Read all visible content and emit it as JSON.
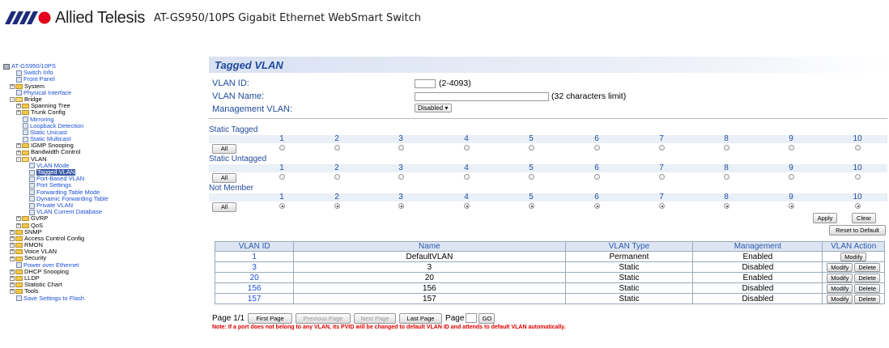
{
  "header": {
    "brand": "Allied Telesis",
    "model_title": "AT-GS950/10PS Gigabit Ethernet WebSmart Switch"
  },
  "tree": [
    {
      "label": "AT-GS950/10PS",
      "type": "root",
      "indent": 0
    },
    {
      "label": "Switch Info",
      "type": "page",
      "indent": 1
    },
    {
      "label": "Front Panel",
      "type": "page",
      "indent": 1
    },
    {
      "label": "System",
      "type": "folder",
      "indent": 1,
      "expand": "+"
    },
    {
      "label": "Physical Interface",
      "type": "page",
      "indent": 1
    },
    {
      "label": "Bridge",
      "type": "folder-open",
      "indent": 1,
      "expand": "-"
    },
    {
      "label": "Spanning Tree",
      "type": "folder",
      "indent": 2,
      "expand": "+"
    },
    {
      "label": "Trunk Config",
      "type": "folder",
      "indent": 2,
      "expand": "+"
    },
    {
      "label": "Mirroring",
      "type": "page",
      "indent": 2
    },
    {
      "label": "Loopback Detection",
      "type": "page",
      "indent": 2
    },
    {
      "label": "Static Unicast",
      "type": "page",
      "indent": 2
    },
    {
      "label": "Static Multicast",
      "type": "page",
      "indent": 2
    },
    {
      "label": "IGMP Snooping",
      "type": "folder",
      "indent": 2,
      "expand": "+"
    },
    {
      "label": "Bandwidth Control",
      "type": "folder",
      "indent": 2,
      "expand": "+"
    },
    {
      "label": "VLAN",
      "type": "folder-open",
      "indent": 2,
      "expand": "-"
    },
    {
      "label": "VLAN Mode",
      "type": "page",
      "indent": 3
    },
    {
      "label": "Tagged VLAN",
      "type": "page",
      "indent": 3,
      "selected": true
    },
    {
      "label": "Port-Based VLAN",
      "type": "page",
      "indent": 3
    },
    {
      "label": "Port Settings",
      "type": "page",
      "indent": 3
    },
    {
      "label": "Forwarding Table Mode",
      "type": "page",
      "indent": 3
    },
    {
      "label": "Dynamic Forwarding Table",
      "type": "page",
      "indent": 3
    },
    {
      "label": "Private VLAN",
      "type": "page",
      "indent": 3
    },
    {
      "label": "VLAN Current Database",
      "type": "page",
      "indent": 3
    },
    {
      "label": "GVRP",
      "type": "folder",
      "indent": 2,
      "expand": "+"
    },
    {
      "label": "QoS",
      "type": "folder",
      "indent": 2,
      "expand": "+"
    },
    {
      "label": "SNMP",
      "type": "folder",
      "indent": 1,
      "expand": "+"
    },
    {
      "label": "Access Control Config",
      "type": "folder",
      "indent": 1,
      "expand": "+"
    },
    {
      "label": "RMON",
      "type": "folder",
      "indent": 1,
      "expand": "+"
    },
    {
      "label": "Voice VLAN",
      "type": "folder",
      "indent": 1,
      "expand": "+"
    },
    {
      "label": "Security",
      "type": "folder",
      "indent": 1,
      "expand": "+"
    },
    {
      "label": "Power over Ethernet",
      "type": "page",
      "indent": 1
    },
    {
      "label": "DHCP Snooping",
      "type": "folder",
      "indent": 1,
      "expand": "+"
    },
    {
      "label": "LLDP",
      "type": "folder",
      "indent": 1,
      "expand": "+"
    },
    {
      "label": "Statistic Chart",
      "type": "folder",
      "indent": 1,
      "expand": "+"
    },
    {
      "label": "Tools",
      "type": "folder",
      "indent": 1,
      "expand": "+"
    },
    {
      "label": "Save Settings to Flash",
      "type": "page",
      "indent": 1
    }
  ],
  "main": {
    "title": "Tagged VLAN",
    "vlan_id_label": "VLAN ID:",
    "vlan_id_value": "",
    "vlan_id_hint": "(2-4093)",
    "vlan_name_label": "VLAN Name:",
    "vlan_name_value": "",
    "vlan_name_hint": "(32 characters limit)",
    "mgmt_label": "Management VLAN:",
    "mgmt_value": "Disabled",
    "sections": [
      {
        "label": "Static Tagged",
        "all": "All",
        "checked": []
      },
      {
        "label": "Static Untagged",
        "all": "All",
        "checked": []
      },
      {
        "label": "Not Member",
        "all": "All",
        "checked": [
          1,
          2,
          3,
          4,
          5,
          6,
          7,
          8,
          9,
          10
        ]
      }
    ],
    "ports": [
      "1",
      "2",
      "3",
      "4",
      "5",
      "6",
      "7",
      "8",
      "9",
      "10"
    ],
    "apply": "Apply",
    "clear": "Clear",
    "reset": "Reset to Default",
    "table": {
      "headers": [
        "VLAN ID",
        "Name",
        "VLAN Type",
        "Management",
        "VLAN Action"
      ],
      "rows": [
        {
          "id": "1",
          "name": "DefaultVLAN",
          "type": "Permanent",
          "mgmt": "Enabled",
          "actions": [
            "Modify"
          ]
        },
        {
          "id": "3",
          "name": "3",
          "type": "Static",
          "mgmt": "Disabled",
          "actions": [
            "Modify",
            "Delete"
          ]
        },
        {
          "id": "20",
          "name": "20",
          "type": "Static",
          "mgmt": "Enabled",
          "actions": [
            "Modify",
            "Delete"
          ]
        },
        {
          "id": "156",
          "name": "156",
          "type": "Static",
          "mgmt": "Disabled",
          "actions": [
            "Modify",
            "Delete"
          ]
        },
        {
          "id": "157",
          "name": "157",
          "type": "Static",
          "mgmt": "Disabled",
          "actions": [
            "Modify",
            "Delete"
          ]
        }
      ]
    },
    "pager": {
      "page_info": "Page 1/1",
      "first": "First Page",
      "prev": "Previous Page",
      "next": "Next Page",
      "last": "Last Page",
      "page_label": "Page",
      "page_value": "",
      "go": "GO"
    },
    "note": "Note: If a port does not belong to any VLAN, its PVID will be changed to default VLAN ID and attends to default VLAN automatically."
  }
}
